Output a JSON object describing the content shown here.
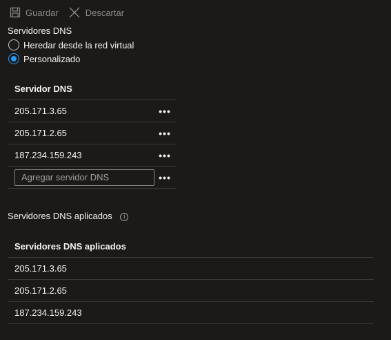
{
  "toolbar": {
    "save_label": "Guardar",
    "discard_label": "Descartar"
  },
  "dns_servers": {
    "label": "Servidores DNS",
    "options": [
      {
        "label": "Heredar desde la red virtual",
        "selected": false
      },
      {
        "label": "Personalizado",
        "selected": true
      }
    ]
  },
  "dns_grid": {
    "header": "Servidor DNS",
    "rows": [
      "205.171.3.65",
      "205.171.2.65",
      "187.234.159.243"
    ],
    "add_placeholder": "Agregar servidor DNS",
    "more_glyph": "•••"
  },
  "applied": {
    "label": "Servidores DNS aplicados",
    "info_glyph": "i",
    "header": "Servidores DNS aplicados",
    "rows": [
      "205.171.3.65",
      "205.171.2.65",
      "187.234.159.243"
    ]
  },
  "colors": {
    "background": "#1b1a19",
    "accent": "#2899f5",
    "disabled_text": "#8a8886",
    "divider": "#3b3a39"
  }
}
